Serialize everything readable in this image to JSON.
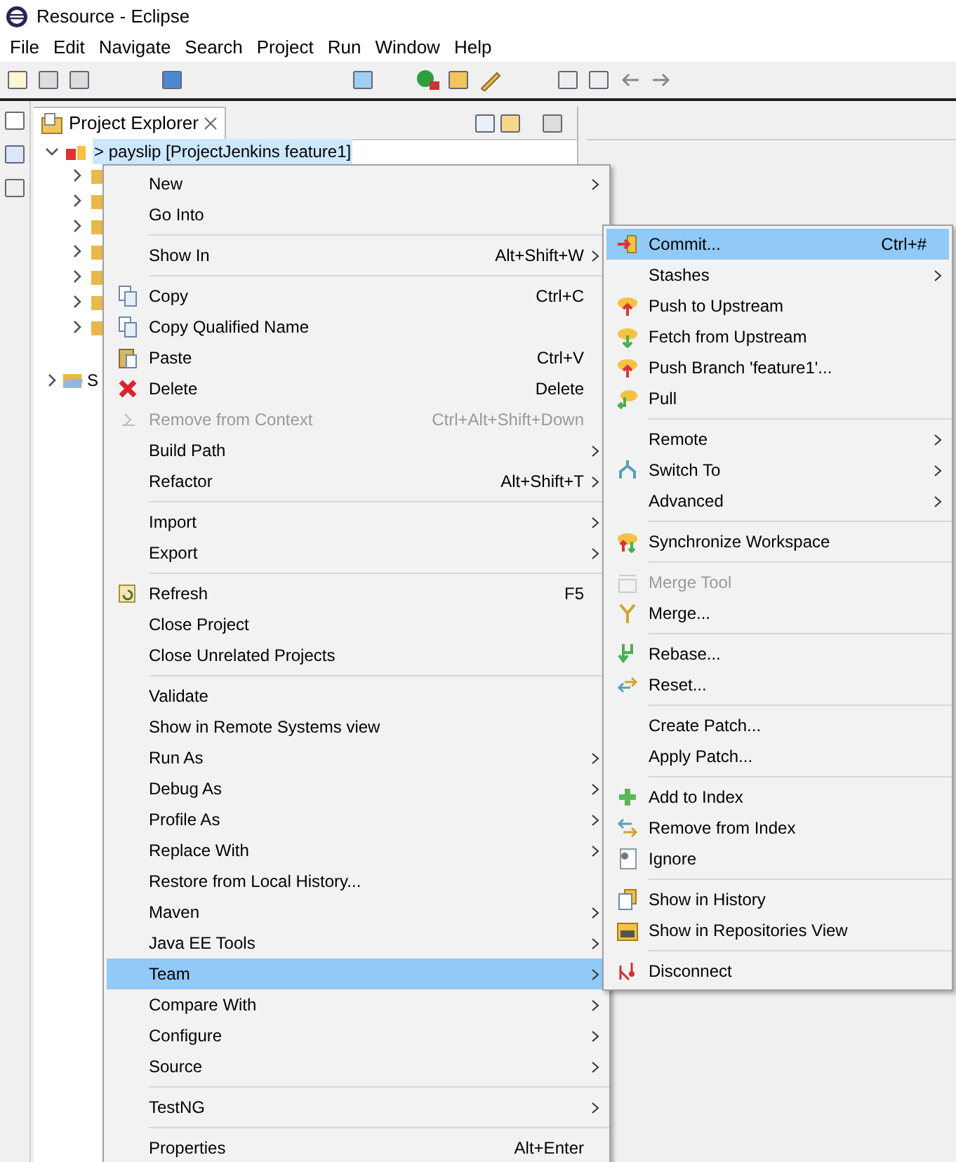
{
  "window": {
    "title": "Resource - Eclipse"
  },
  "menu_bar": [
    "File",
    "Edit",
    "Navigate",
    "Search",
    "Project",
    "Run",
    "Window",
    "Help"
  ],
  "view": {
    "tab": "Project Explorer",
    "selected": true
  },
  "tree": {
    "root": {
      "label": "> payslip  [ProjectJenkins feature1]",
      "expanded": true,
      "selected": true
    },
    "children": [
      {
        "expanded": false
      },
      {
        "expanded": false
      },
      {
        "expanded": false
      },
      {
        "expanded": false
      },
      {
        "expanded": false
      },
      {
        "expanded": false
      },
      {
        "expanded": false
      }
    ],
    "sibling": {
      "label": "S",
      "expanded": false
    }
  },
  "context_menu": [
    {
      "kind": "item",
      "label": "New",
      "submenu": true
    },
    {
      "kind": "item",
      "label": "Go Into"
    },
    {
      "kind": "separator"
    },
    {
      "kind": "item",
      "label": "Show In",
      "shortcut": "Alt+Shift+W",
      "submenu": true
    },
    {
      "kind": "separator"
    },
    {
      "kind": "item",
      "label": "Copy",
      "shortcut": "Ctrl+C"
    },
    {
      "kind": "item",
      "label": "Copy Qualified Name"
    },
    {
      "kind": "item",
      "label": "Paste",
      "shortcut": "Ctrl+V"
    },
    {
      "kind": "item",
      "label": "Delete",
      "shortcut": "Delete"
    },
    {
      "kind": "item",
      "label": "Remove from Context",
      "shortcut": "Ctrl+Alt+Shift+Down",
      "disabled": true
    },
    {
      "kind": "item",
      "label": "Build Path",
      "submenu": true
    },
    {
      "kind": "item",
      "label": "Refactor",
      "shortcut": "Alt+Shift+T",
      "submenu": true
    },
    {
      "kind": "separator"
    },
    {
      "kind": "item",
      "label": "Import",
      "submenu": true
    },
    {
      "kind": "item",
      "label": "Export",
      "submenu": true
    },
    {
      "kind": "separator"
    },
    {
      "kind": "item",
      "label": "Refresh",
      "shortcut": "F5"
    },
    {
      "kind": "item",
      "label": "Close Project"
    },
    {
      "kind": "item",
      "label": "Close Unrelated Projects"
    },
    {
      "kind": "separator"
    },
    {
      "kind": "item",
      "label": "Validate"
    },
    {
      "kind": "item",
      "label": "Show in Remote Systems view"
    },
    {
      "kind": "item",
      "label": "Run As",
      "submenu": true
    },
    {
      "kind": "item",
      "label": "Debug As",
      "submenu": true
    },
    {
      "kind": "item",
      "label": "Profile As",
      "submenu": true
    },
    {
      "kind": "item",
      "label": "Replace With",
      "submenu": true
    },
    {
      "kind": "item",
      "label": "Restore from Local History..."
    },
    {
      "kind": "item",
      "label": "Maven",
      "submenu": true
    },
    {
      "kind": "item",
      "label": "Java EE Tools",
      "submenu": true
    },
    {
      "kind": "item",
      "label": "Team",
      "submenu": true,
      "selected": true
    },
    {
      "kind": "item",
      "label": "Compare With",
      "submenu": true
    },
    {
      "kind": "item",
      "label": "Configure",
      "submenu": true
    },
    {
      "kind": "item",
      "label": "Source",
      "submenu": true
    },
    {
      "kind": "separator"
    },
    {
      "kind": "item",
      "label": "TestNG",
      "submenu": true
    },
    {
      "kind": "separator"
    },
    {
      "kind": "item",
      "label": "Properties",
      "shortcut": "Alt+Enter"
    }
  ],
  "team_submenu": [
    {
      "kind": "item",
      "label": "Commit...",
      "shortcut": "Ctrl+#",
      "selected": true
    },
    {
      "kind": "item",
      "label": "Stashes",
      "submenu": true
    },
    {
      "kind": "item",
      "label": "Push to Upstream"
    },
    {
      "kind": "item",
      "label": "Fetch from Upstream"
    },
    {
      "kind": "item",
      "label": "Push Branch 'feature1'..."
    },
    {
      "kind": "item",
      "label": "Pull"
    },
    {
      "kind": "separator"
    },
    {
      "kind": "item",
      "label": "Remote",
      "submenu": true
    },
    {
      "kind": "item",
      "label": "Switch To",
      "submenu": true
    },
    {
      "kind": "item",
      "label": "Advanced",
      "submenu": true
    },
    {
      "kind": "separator"
    },
    {
      "kind": "item",
      "label": "Synchronize Workspace"
    },
    {
      "kind": "separator"
    },
    {
      "kind": "item",
      "label": "Merge Tool",
      "disabled": true
    },
    {
      "kind": "item",
      "label": "Merge..."
    },
    {
      "kind": "separator"
    },
    {
      "kind": "item",
      "label": "Rebase..."
    },
    {
      "kind": "item",
      "label": "Reset..."
    },
    {
      "kind": "separator"
    },
    {
      "kind": "item",
      "label": "Create Patch..."
    },
    {
      "kind": "item",
      "label": "Apply Patch..."
    },
    {
      "kind": "separator"
    },
    {
      "kind": "item",
      "label": "Add to Index"
    },
    {
      "kind": "item",
      "label": "Remove from Index"
    },
    {
      "kind": "item",
      "label": "Ignore"
    },
    {
      "kind": "separator"
    },
    {
      "kind": "item",
      "label": "Show in History"
    },
    {
      "kind": "item",
      "label": "Show in Repositories View"
    },
    {
      "kind": "separator"
    },
    {
      "kind": "item",
      "label": "Disconnect"
    }
  ]
}
